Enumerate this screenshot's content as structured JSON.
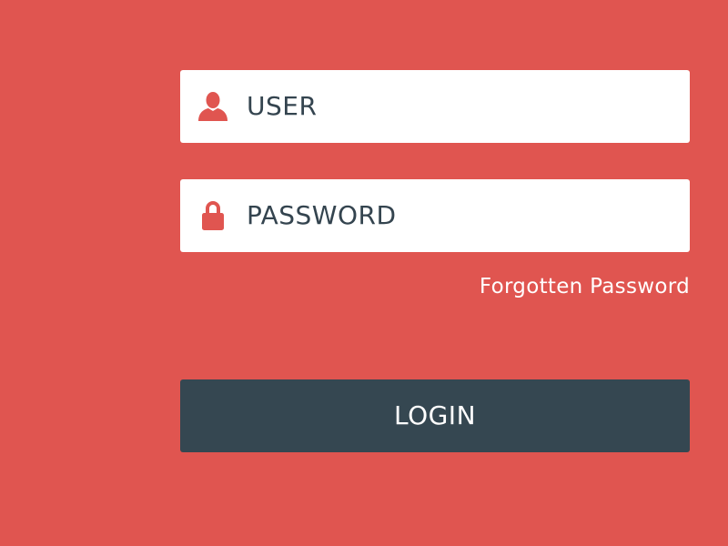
{
  "form": {
    "user": {
      "icon": "user-icon",
      "placeholder": "USER"
    },
    "password": {
      "icon": "lock-icon",
      "placeholder": "PASSWORD"
    },
    "forgot_link": "Forgotten Password",
    "login_label": "LOGIN"
  },
  "colors": {
    "background": "#E05550",
    "field_background": "#FFFFFF",
    "icon": "#E05550",
    "field_text": "#34444F",
    "button_background": "#354751",
    "button_text": "#FFFFFF"
  }
}
